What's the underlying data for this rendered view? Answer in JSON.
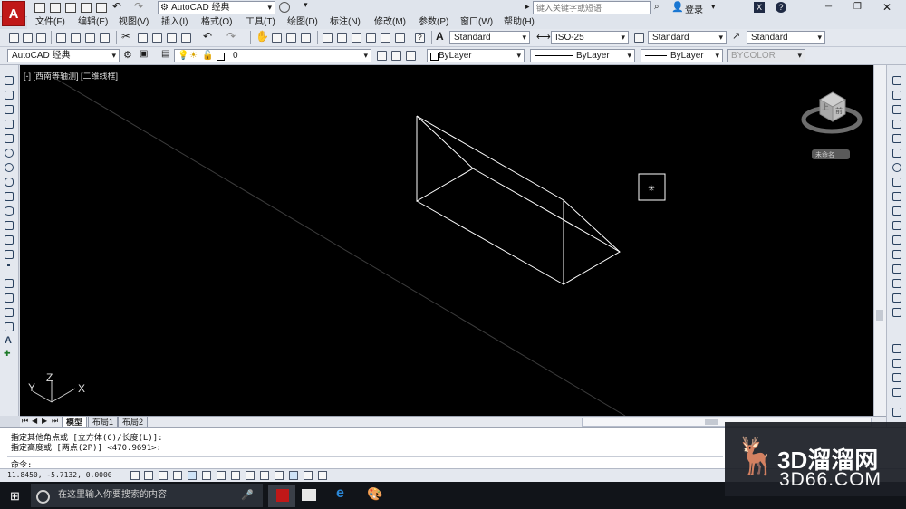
{
  "app": {
    "logo_letter": "A"
  },
  "titlebar": {
    "workspace": "AutoCAD 经典",
    "search_placeholder": "键入关键字或短语",
    "login_label": "登录",
    "icons": [
      "new-icon",
      "open-icon",
      "save-icon",
      "saveas-icon",
      "print-icon",
      "undo-icon",
      "redo-icon",
      "gear-icon",
      "help-icon",
      "minimize-icon",
      "restore-icon",
      "close-icon"
    ]
  },
  "menu": {
    "items": [
      "文件(F)",
      "编辑(E)",
      "视图(V)",
      "插入(I)",
      "格式(O)",
      "工具(T)",
      "绘图(D)",
      "标注(N)",
      "修改(M)",
      "参数(P)",
      "窗口(W)",
      "帮助(H)"
    ]
  },
  "toolbar1": {
    "text_style": "Standard",
    "dim_style": "ISO-25",
    "table_style": "Standard",
    "multileader_style": "Standard"
  },
  "toolbar2": {
    "workspace": "AutoCAD 经典",
    "layer": "0",
    "color": "ByLayer",
    "linetype": "ByLayer",
    "lineweight": "ByLayer",
    "plotstyle": "BYCOLOR"
  },
  "viewport": {
    "label": "[-] [西南等轴测] [二维线框]",
    "viewcube_face": "前",
    "viewcube_corner": "上",
    "wcs_label": "未命名",
    "ucs": {
      "x": "X",
      "y": "Y",
      "z": "Z"
    }
  },
  "tabs": [
    "模型",
    "布局1",
    "布局2"
  ],
  "commandline": {
    "line1": "指定其他角点或 [立方体(C)/长度(L)]:",
    "line2": "指定高度或 [两点(2P)] <470.9691>:",
    "prompt": "命令:"
  },
  "statusbar": {
    "coords": "11.8450, -5.7132, 0.0000"
  },
  "taskbar": {
    "search_text": "在这里输入你要搜索的内容"
  },
  "watermark": {
    "brand": "3D溜溜网",
    "url": "3D66.COM"
  },
  "colors": {
    "logo_red": "#c01818",
    "viewport_bg": "#000000",
    "taskbar": "#111419",
    "wireframe": "#ffffff"
  }
}
